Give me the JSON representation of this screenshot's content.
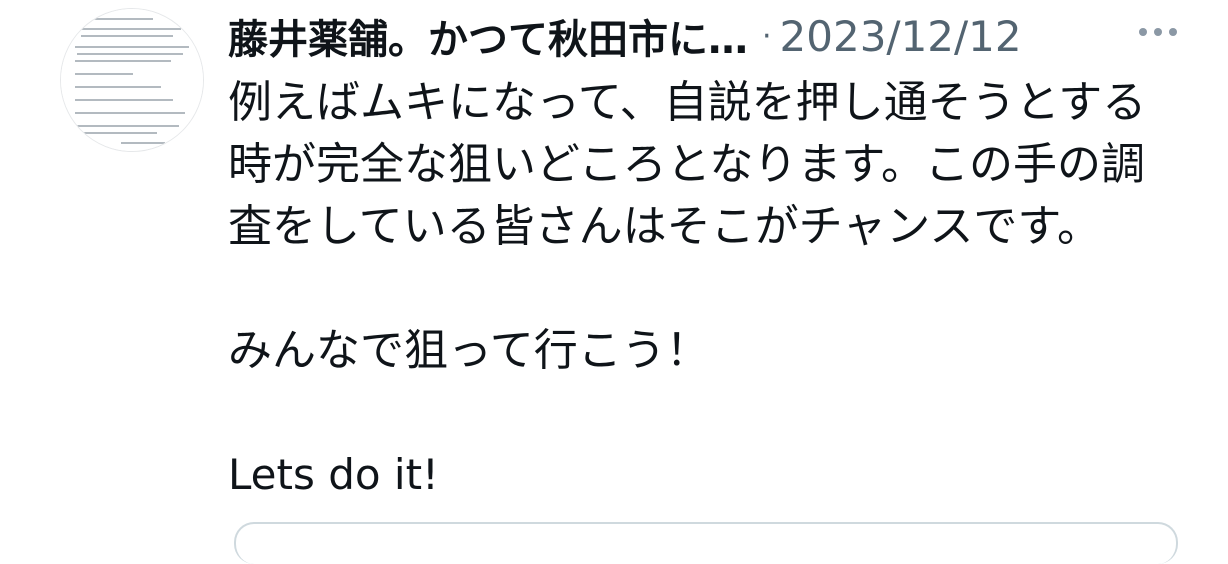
{
  "tweet": {
    "display_name": "藤井薬舗。かつて秋田市に…",
    "separator": "·",
    "date": "2023/12/12",
    "more_icon": "more-horizontal-icon",
    "lines": [
      "例えばムキになって、自説を押し通そうとする",
      "時が完全な狙いどころとなります。この手の調",
      "査をしている皆さんはそこがチャンスです。",
      "",
      "みんなで狙って行こう！",
      "",
      "Lets do it!"
    ]
  },
  "colors": {
    "text": "#0f1419",
    "secondary": "#536471",
    "border": "#cfd9de"
  }
}
